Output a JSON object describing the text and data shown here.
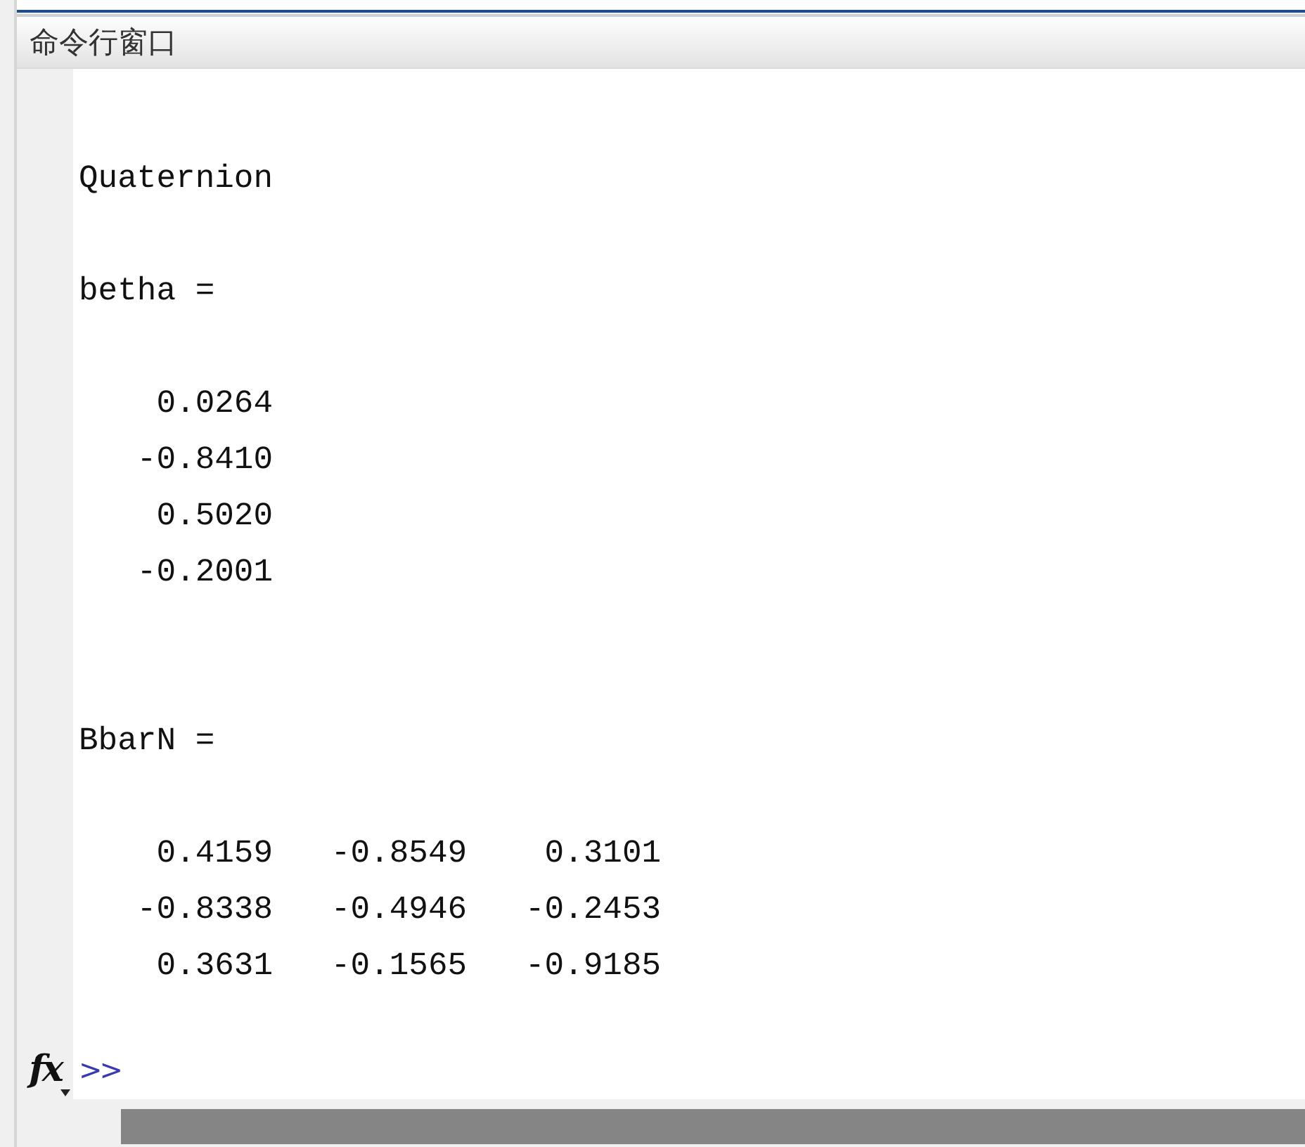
{
  "panel": {
    "title": "命令行窗口"
  },
  "output": [
    {
      "kind": "blank"
    },
    {
      "kind": "text",
      "text": "Quaternion"
    },
    {
      "kind": "blank"
    },
    {
      "kind": "text",
      "text": "betha ="
    },
    {
      "kind": "blank"
    },
    {
      "kind": "text",
      "text": "    0.0264"
    },
    {
      "kind": "text",
      "text": "   -0.8410"
    },
    {
      "kind": "text",
      "text": "    0.5020"
    },
    {
      "kind": "text",
      "text": "   -0.2001"
    },
    {
      "kind": "blank"
    },
    {
      "kind": "blank"
    },
    {
      "kind": "text",
      "text": "BbarN ="
    },
    {
      "kind": "blank"
    },
    {
      "kind": "text",
      "text": "    0.4159   -0.8549    0.3101"
    },
    {
      "kind": "text",
      "text": "   -0.8338   -0.4946   -0.2453"
    },
    {
      "kind": "text",
      "text": "    0.3631   -0.1565   -0.9185"
    },
    {
      "kind": "blank"
    }
  ],
  "prompt": {
    "function_button": "fx",
    "symbol": ">>"
  }
}
